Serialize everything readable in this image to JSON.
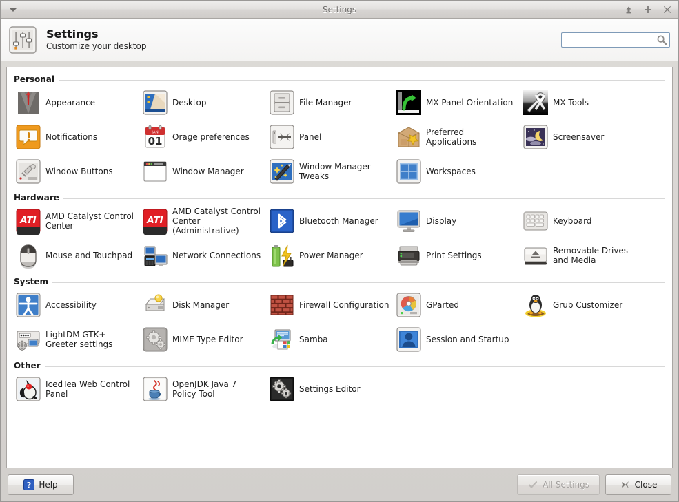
{
  "window": {
    "title": "Settings",
    "menu_button": "window-menu",
    "controls": [
      {
        "name": "shade-button",
        "glyph": "shade"
      },
      {
        "name": "maximize-button",
        "glyph": "maximize"
      },
      {
        "name": "close-button",
        "glyph": "close"
      }
    ]
  },
  "header": {
    "title": "Settings",
    "subtitle": "Customize your desktop",
    "icon": "settings-sliders-icon"
  },
  "search": {
    "value": "",
    "placeholder": "",
    "icon": "search-icon"
  },
  "sections": [
    {
      "title": "Personal",
      "items": [
        {
          "label": "Appearance",
          "icon": "appearance-suit-icon"
        },
        {
          "label": "Desktop",
          "icon": "desktop-wallpaper-icon"
        },
        {
          "label": "File Manager",
          "icon": "file-manager-cabinet-icon"
        },
        {
          "label": "MX Panel Orientation",
          "icon": "mx-panel-orientation-icon"
        },
        {
          "label": "MX Tools",
          "icon": "mx-tools-icon"
        },
        {
          "label": "Notifications",
          "icon": "notifications-bubble-icon"
        },
        {
          "label": "Orage preferences",
          "icon": "orage-calendar-icon"
        },
        {
          "label": "Panel",
          "icon": "panel-icon"
        },
        {
          "label": "Preferred Applications",
          "icon": "preferred-applications-icon"
        },
        {
          "label": "Screensaver",
          "icon": "screensaver-moon-icon"
        },
        {
          "label": "Window Buttons",
          "icon": "window-buttons-icon"
        },
        {
          "label": "Window Manager",
          "icon": "window-manager-icon"
        },
        {
          "label": "Window Manager Tweaks",
          "icon": "window-manager-tweaks-icon"
        },
        {
          "label": "Workspaces",
          "icon": "workspaces-icon"
        }
      ]
    },
    {
      "title": "Hardware",
      "items": [
        {
          "label": "AMD Catalyst Control Center",
          "icon": "ati-logo-icon"
        },
        {
          "label": "AMD Catalyst Control Center (Administrative)",
          "icon": "ati-logo-icon"
        },
        {
          "label": "Bluetooth Manager",
          "icon": "bluetooth-icon"
        },
        {
          "label": "Display",
          "icon": "display-monitor-icon"
        },
        {
          "label": "Keyboard",
          "icon": "keyboard-icon"
        },
        {
          "label": "Mouse and Touchpad",
          "icon": "mouse-icon"
        },
        {
          "label": "Network Connections",
          "icon": "network-connections-icon"
        },
        {
          "label": "Power Manager",
          "icon": "power-battery-icon"
        },
        {
          "label": "Print Settings",
          "icon": "printer-icon"
        },
        {
          "label": "Removable Drives and Media",
          "icon": "removable-drive-eject-icon"
        }
      ]
    },
    {
      "title": "System",
      "items": [
        {
          "label": "Accessibility",
          "icon": "accessibility-person-icon"
        },
        {
          "label": "Disk Manager",
          "icon": "disk-manager-icon"
        },
        {
          "label": "Firewall Configuration",
          "icon": "firewall-brickwall-icon"
        },
        {
          "label": "GParted",
          "icon": "gparted-pie-disk-icon"
        },
        {
          "label": "Grub Customizer",
          "icon": "grub-penguin-icon"
        },
        {
          "label": "LightDM GTK+ Greeter settings",
          "icon": "lightdm-greeter-icon"
        },
        {
          "label": "MIME Type Editor",
          "icon": "mime-type-gears-icon"
        },
        {
          "label": "Samba",
          "icon": "samba-share-icon"
        },
        {
          "label": "Session and Startup",
          "icon": "session-user-icon"
        }
      ]
    },
    {
      "title": "Other",
      "items": [
        {
          "label": "IcedTea Web Control Panel",
          "icon": "icedtea-duke-icon"
        },
        {
          "label": "OpenJDK Java 7 Policy Tool",
          "icon": "java-coffee-icon"
        },
        {
          "label": "Settings Editor",
          "icon": "settings-editor-gears-icon"
        }
      ]
    }
  ],
  "buttons": {
    "help": "Help",
    "all_settings": "All Settings",
    "close": "Close"
  },
  "colors": {
    "window_bg": "#d6d3d1",
    "content_bg": "#ffffff",
    "accent_blue": "#3a6ea5",
    "ati_red": "#d81f24",
    "focus_border": "#7f9bb8"
  }
}
